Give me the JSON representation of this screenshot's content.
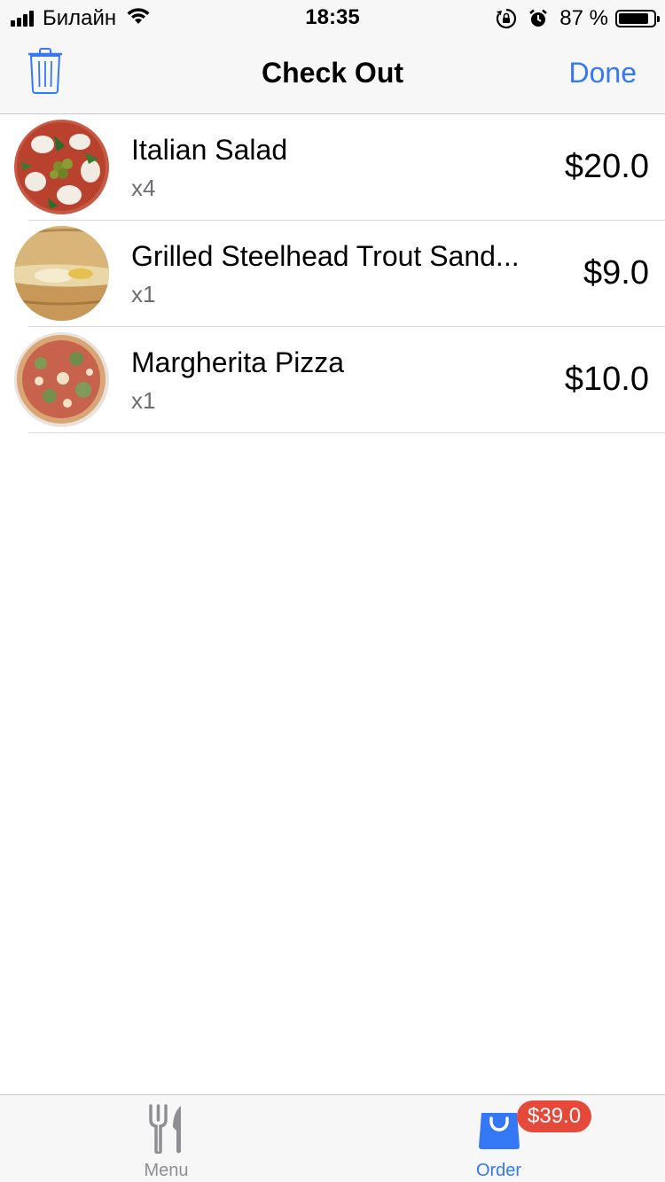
{
  "status_bar": {
    "carrier": "Билайн",
    "time": "18:35",
    "battery_text": "87 %",
    "battery_level": 0.87,
    "icons": [
      "signal-icon",
      "wifi-icon",
      "orientation-lock-icon",
      "alarm-icon",
      "battery-icon"
    ]
  },
  "nav": {
    "title": "Check Out",
    "done_label": "Done",
    "left_icon": "trash-icon"
  },
  "items": [
    {
      "name": "Italian Salad",
      "qty": "x4",
      "price": "$20.0"
    },
    {
      "name": "Grilled Steelhead Trout Sand...",
      "qty": "x1",
      "price": "$9.0"
    },
    {
      "name": "Margherita Pizza",
      "qty": "x1",
      "price": "$10.0"
    }
  ],
  "tabs": {
    "menu_label": "Menu",
    "order_label": "Order",
    "order_badge": "$39.0",
    "active": "Order"
  },
  "colors": {
    "accent": "#3478f6",
    "badge": "#e5493a",
    "inactive": "#8e8e93"
  }
}
